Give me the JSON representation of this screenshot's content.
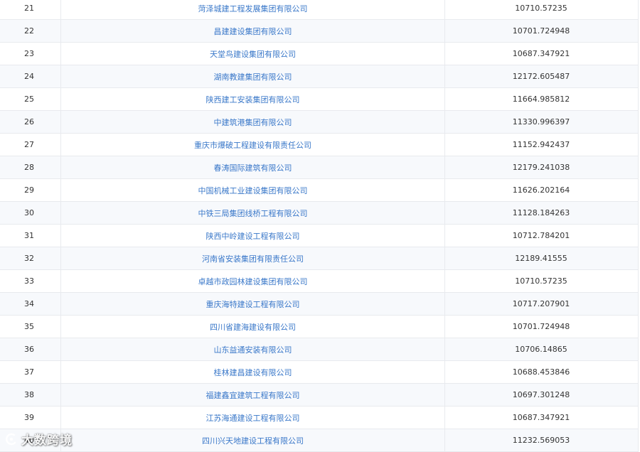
{
  "rows": [
    {
      "rank": "21",
      "name": "菏泽城建工程发展集团有限公司",
      "value": "10710.57235"
    },
    {
      "rank": "22",
      "name": "昌建建设集团有限公司",
      "value": "10701.724948"
    },
    {
      "rank": "23",
      "name": "天堂鸟建设集团有限公司",
      "value": "10687.347921"
    },
    {
      "rank": "24",
      "name": "湖南教建集团有限公司",
      "value": "12172.605487"
    },
    {
      "rank": "25",
      "name": "陕西建工安装集团有限公司",
      "value": "11664.985812"
    },
    {
      "rank": "26",
      "name": "中建筑港集团有限公司",
      "value": "11330.996397"
    },
    {
      "rank": "27",
      "name": "重庆市爆破工程建设有限责任公司",
      "value": "11152.942437"
    },
    {
      "rank": "28",
      "name": "春涛国际建筑有限公司",
      "value": "12179.241038"
    },
    {
      "rank": "29",
      "name": "中国机械工业建设集团有限公司",
      "value": "11626.202164"
    },
    {
      "rank": "30",
      "name": "中铁三局集团线桥工程有限公司",
      "value": "11128.184263"
    },
    {
      "rank": "31",
      "name": "陕西中岭建设工程有限公司",
      "value": "10712.784201"
    },
    {
      "rank": "32",
      "name": "河南省安装集团有限责任公司",
      "value": "12189.41555"
    },
    {
      "rank": "33",
      "name": "卓越市政园林建设集团有限公司",
      "value": "10710.57235"
    },
    {
      "rank": "34",
      "name": "重庆海特建设工程有限公司",
      "value": "10717.207901"
    },
    {
      "rank": "35",
      "name": "四川省建海建设有限公司",
      "value": "10701.724948"
    },
    {
      "rank": "36",
      "name": "山东益通安装有限公司",
      "value": "10706.14865"
    },
    {
      "rank": "37",
      "name": "桂林建昌建设有限公司",
      "value": "10688.453846"
    },
    {
      "rank": "38",
      "name": "福建鑫宜建筑工程有限公司",
      "value": "10697.301248"
    },
    {
      "rank": "39",
      "name": "江苏海通建设工程有限公司",
      "value": "10687.347921"
    },
    {
      "rank": "40",
      "name": "四川兴天地建设工程有限公司",
      "value": "11232.569053"
    }
  ],
  "watermark": {
    "text": "大数跨境"
  },
  "colors": {
    "link": "#3a78c9",
    "border": "#e8eaee",
    "alt_row": "#f7f9fc"
  }
}
